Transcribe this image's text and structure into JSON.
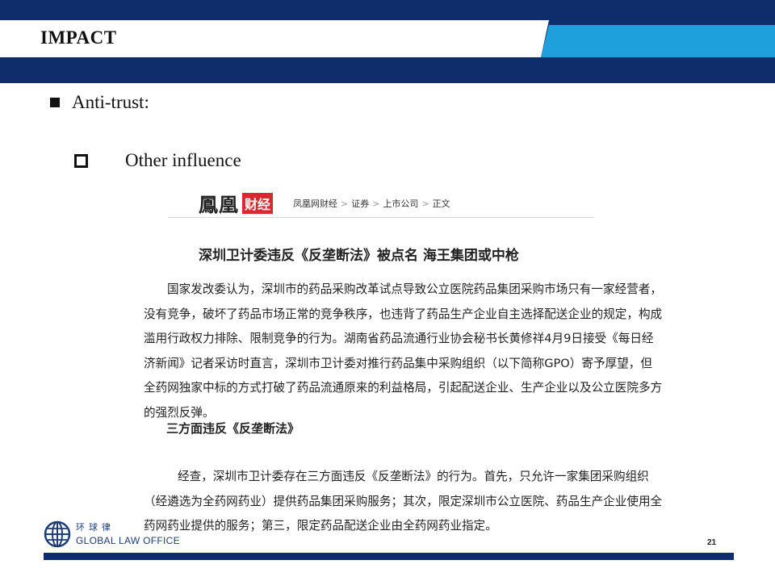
{
  "header": {
    "title": "IMPACT"
  },
  "bullets": {
    "level1": "Anti-trust:",
    "level2": "Other influence"
  },
  "clipping": {
    "brand_main": "鳳凰",
    "brand_tag": "财经",
    "breadcrumb": [
      "凤凰网财经",
      "证券",
      "上市公司",
      "正文"
    ],
    "breadcrumb_separator": ">",
    "headline": "深圳卫计委违反《反垄断法》被点名 海王集团或中枪",
    "paragraph1": "国家发改委认为，深圳市的药品采购改革试点导致公立医院药品集团采购市场只有一家经营者，没有竞争，破坏了药品市场正常的竞争秩序，也违背了药品生产企业自主选择配送企业的规定，构成滥用行政权力排除、限制竞争的行为。湖南省药品流通行业协会秘书长黄修祥4月9日接受《每日经济新闻》记者采访时直言，深圳市卫计委对推行药品集中采购组织（以下简称GPO）寄予厚望，但全药网独家中标的方式打破了药品流通原来的利益格局，引起配送企业、生产企业以及公立医院多方的强烈反弹。",
    "subheading": "三方面违反《反垄断法》",
    "paragraph2": "经查，深圳市卫计委存在三方面违反《反垄断法》的行为。首先，只允许一家集团采购组织（经遴选为全药网药业）提供药品集团采购服务；其次，限定深圳市公立医院、药品生产企业使用全药网药业提供的服务；第三，限定药品配送企业由全药网药业指定。"
  },
  "footer": {
    "logo_cn": "环球律",
    "logo_en": "GLOBAL LAW OFFICE",
    "page_number": "21"
  },
  "colors": {
    "navy": "#0f2d6b",
    "accent_blue": "#1ea0dc",
    "brand_red": "#d9282f"
  }
}
